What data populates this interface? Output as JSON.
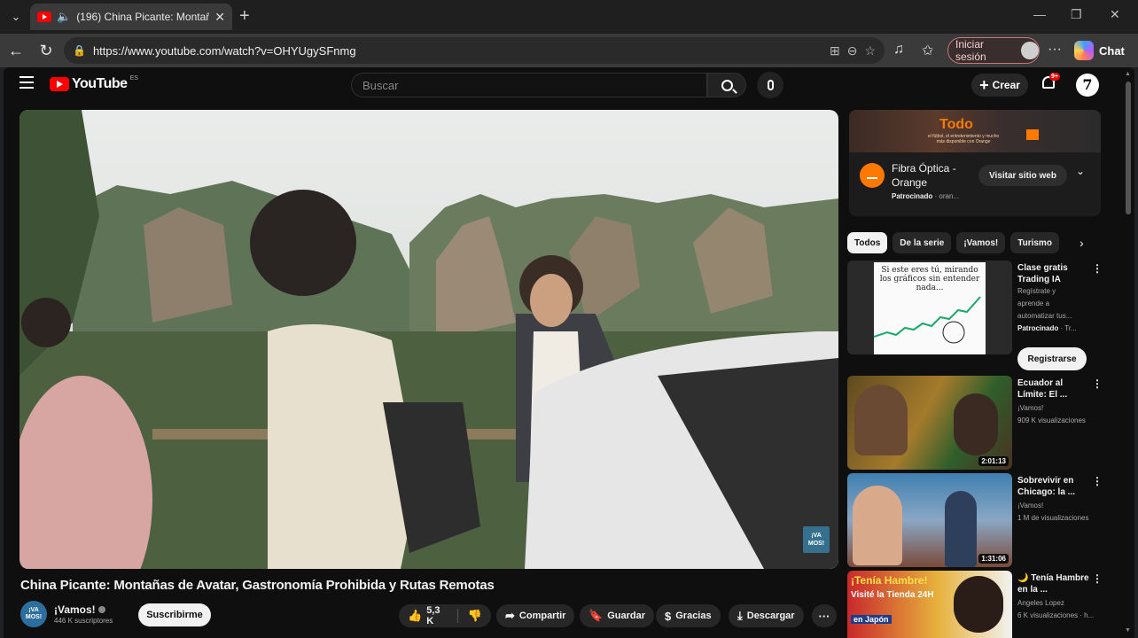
{
  "browser": {
    "tab_title": "(196) China Picante: Montañas",
    "url": "https://www.youtube.com/watch?v=OHYUgySFnmg",
    "sign_in_label": "Iniciar sesión",
    "copilot_label": "Chat"
  },
  "header": {
    "logo_text": "YouTube",
    "logo_region": "ES",
    "search_placeholder": "Buscar",
    "create_label": "Crear",
    "notifications_badge": "9+",
    "avatar_letter": "7"
  },
  "video": {
    "title": "China Picante: Montañas de Avatar, Gastronomía Prohibida y Rutas Remotas",
    "watermark": "¡VA MOS!",
    "channel_name": "¡Vamos!",
    "channel_avatar_text": "¡VA MOS!",
    "subscribers": "446 K suscriptores",
    "subscribe_label": "Suscribirme",
    "like_count": "5,3 K",
    "share_label": "Compartir",
    "save_label": "Guardar",
    "thanks_label": "Gracias",
    "download_label": "Descargar"
  },
  "ad": {
    "banner_headline": "Todo",
    "banner_sub": "el fútbol, el entretenimiento y mucho más disponible con Orange",
    "title": "Fibra Óptica - Orange",
    "sponsored": "Patrocinado",
    "domain": "oran...",
    "visit_label": "Visitar sitio web"
  },
  "chips": [
    "Todos",
    "De la serie",
    "¡Vamos!",
    "Turismo"
  ],
  "recommendations": [
    {
      "title": "Clase gratis Trading IA",
      "lines": [
        "Regístrate y",
        "aprende a",
        "automatizar tus..."
      ],
      "sponsored": "Patrocinado",
      "sponsor_domain": "· Tr...",
      "cta": "Registrarse",
      "thumb_text": "Si este eres tú, mirando los gráficos sin entender nada..."
    },
    {
      "title": "Ecuador al Límite: El ...",
      "channel": "¡Vamos!",
      "views": "909 K visualizaciones",
      "duration": "2:01:13"
    },
    {
      "title": "Sobrevivir en Chicago: la ...",
      "channel": "¡Vamos!",
      "views": "1 M de visualizaciones",
      "duration": "1:31:06"
    },
    {
      "title": "🌙 Tenía Hambre en la ...",
      "channel": "Angeles Lopez",
      "views": "6 K visualizaciones · h...",
      "thumb_text_1": "¡Tenía Hambre!",
      "thumb_text_2": "Visité la Tienda 24H",
      "thumb_text_3": "en Japón"
    }
  ],
  "colors": {
    "youtube_red": "#ff0000",
    "orange_brand": "#ff7900",
    "page_bg": "#0f0f0f"
  }
}
